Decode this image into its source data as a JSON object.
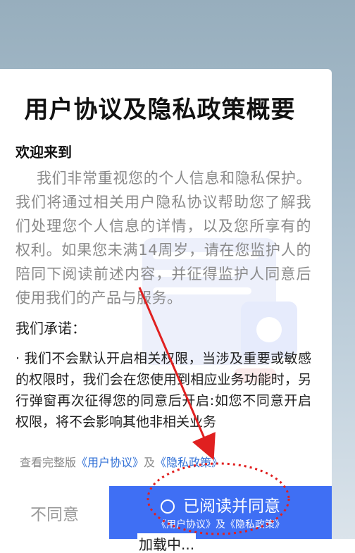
{
  "dialog": {
    "title": "用户协议及隐私政策概要",
    "welcome": "欢迎来到",
    "intro": "我们非常重视您的个人信息和隐私保护。我们将通过相关用户隐私协议帮助您了解我们处理您个人信息的详情，以及您所享有的权利。如果您未满14周岁，请在您监护人的陪同下阅读前述内容，并征得监护人同意后使用我们的产品与服务。",
    "promise_title": "我们承诺：",
    "promise_text": "· 我们不会默认开启相关权限，当涉及重要或敏感的权限时，我们会在您使用到相应业务功能时，另行弹窗再次征得您的同意后开启:如您不同意开启权限，将不会影响其他非相关业务",
    "full_prefix": "查看完整版",
    "user_agreement_link": "《用户协议》",
    "and": "及",
    "privacy_policy_link": "《隐私政策》",
    "disagree_label": "不同意",
    "agree_label": "已阅读并同意",
    "agree_sub": "《用户协议》及《隐私政策》"
  },
  "status": {
    "loading": "加载中..."
  },
  "colors": {
    "accent": "#3f6ff4",
    "link": "#2f6fd6",
    "annotation": "#e02020"
  },
  "icons": {
    "radio": "radio-unchecked-icon",
    "arrow": "annotation-arrow-icon"
  }
}
